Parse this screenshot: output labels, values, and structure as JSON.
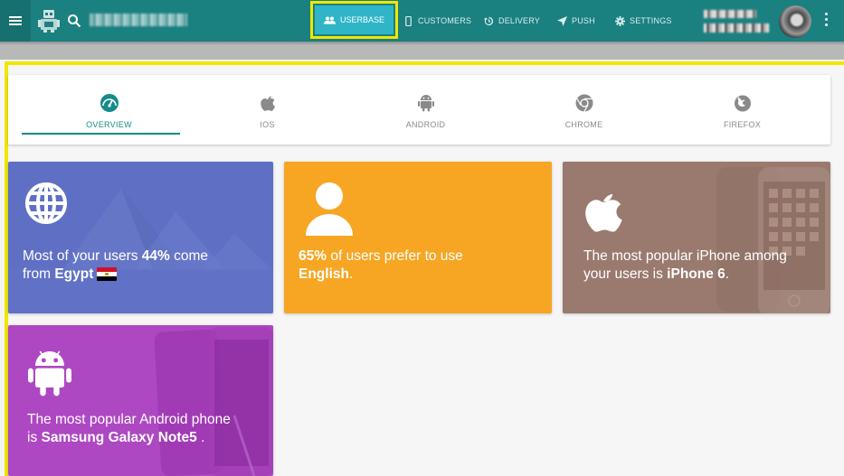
{
  "topbar": {
    "nav": [
      {
        "label": "USERBASE",
        "icon": "group-icon",
        "active": true
      },
      {
        "label": "CUSTOMERS",
        "icon": "phone-icon"
      },
      {
        "label": "DELIVERY",
        "icon": "history-icon"
      },
      {
        "label": "PUSH",
        "icon": "send-icon"
      },
      {
        "label": "SETTINGS",
        "icon": "gear-icon"
      }
    ]
  },
  "tabs": [
    {
      "label": "OVERVIEW",
      "icon": "dashboard-gauge-icon",
      "active": true
    },
    {
      "label": "IOS",
      "icon": "apple-icon"
    },
    {
      "label": "ANDROID",
      "icon": "android-icon"
    },
    {
      "label": "CHROME",
      "icon": "chrome-icon"
    },
    {
      "label": "FIREFOX",
      "icon": "firefox-icon"
    }
  ],
  "cards": {
    "country": {
      "pre": "Most of your users ",
      "percent": "44%",
      "mid": " come",
      "line2_pre": "from ",
      "country": "Egypt",
      "icon": "globe-icon",
      "color": "#5f6fc4"
    },
    "language": {
      "percent": "65%",
      "mid": " of users prefer to use",
      "language": "English",
      "end": ".",
      "icon": "person-icon",
      "color": "#f6a623"
    },
    "iphone": {
      "line1": "The most popular iPhone among",
      "line2_pre": "your users is ",
      "model": "iPhone 6",
      "end": ".",
      "icon": "apple-icon",
      "color": "#9a7a6f"
    },
    "android": {
      "line1": "The most popular Android phone",
      "line2_pre": "is ",
      "model": "Samsung Galaxy Note5",
      "end": " .",
      "icon": "android-icon",
      "color": "#ae48c2"
    }
  }
}
